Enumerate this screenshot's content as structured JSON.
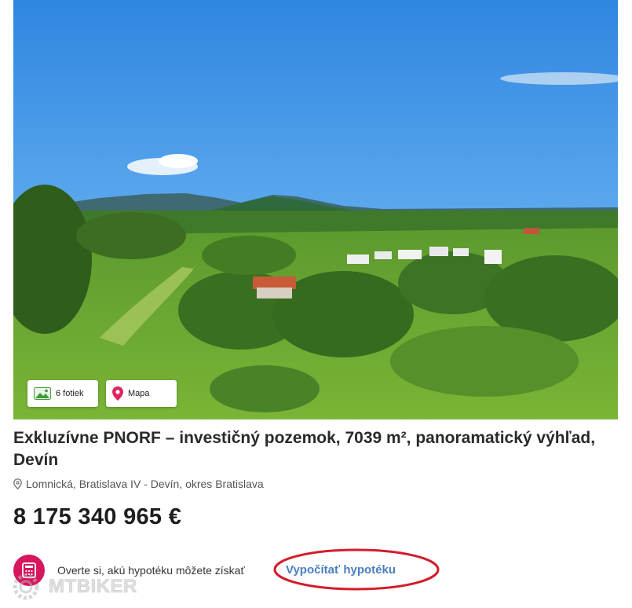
{
  "listing": {
    "photo_alt": "",
    "photos_label": "6 fotiek",
    "map_label": "Mapa",
    "title": "Exkluzívne PNORF – investičný pozemok, 7039 m², panoramatický výhľad, Devín",
    "address": "Lomnická, Bratislava IV - Devín, okres Bratislava",
    "price": "8 175 340 965 €"
  },
  "mortgage": {
    "prompt": "Overte si, akú hypotéku môžete získať",
    "link_label": "Vypočítať hypotéku"
  },
  "watermark": {
    "text": "MTBIKER"
  },
  "colors": {
    "accent_pink": "#d8155f",
    "link_blue": "#4a7fbd",
    "annotation_red": "#d21e2a",
    "map_pin": "#e0245e"
  }
}
